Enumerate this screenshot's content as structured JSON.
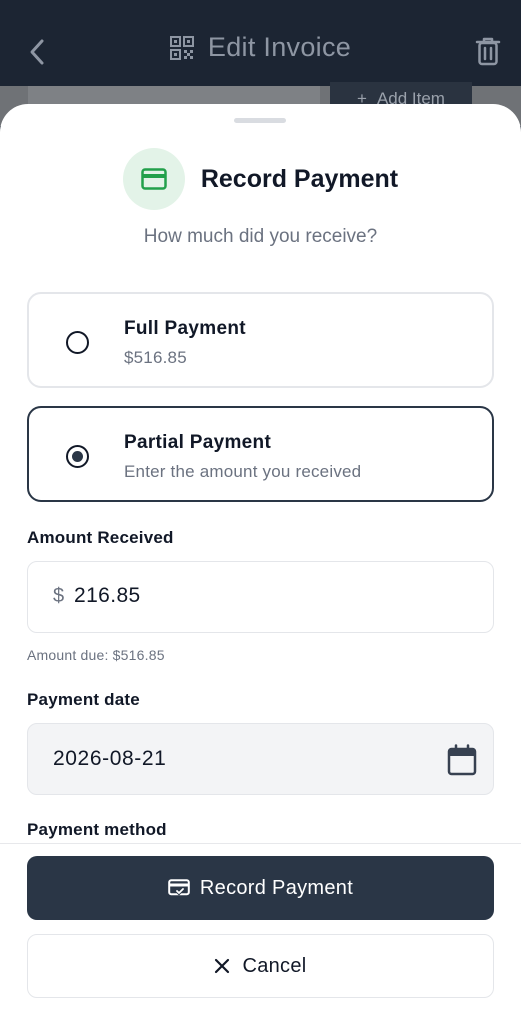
{
  "header": {
    "title": "Edit Invoice",
    "back_icon": "chevron-left-icon",
    "qr_icon": "qr-code-icon",
    "trash_icon": "trash-icon",
    "add_item_label": "Add Item"
  },
  "sheet": {
    "title": "Record Payment",
    "title_icon": "credit-card-icon",
    "subtitle": "How much did you receive?",
    "options": [
      {
        "title": "Full Payment",
        "subtitle": "$516.85",
        "selected": false
      },
      {
        "title": "Partial Payment",
        "subtitle": "Enter the amount you received",
        "selected": true
      }
    ],
    "amount": {
      "label": "Amount Received",
      "currency_symbol": "$",
      "value": "216.85",
      "helper": "Amount due: $516.85"
    },
    "date": {
      "label": "Payment date",
      "value": "2026-08-21"
    },
    "method": {
      "label": "Payment method"
    },
    "primary_button": "Record Payment",
    "cancel_button": "Cancel"
  },
  "colors": {
    "header_bg": "#1c2533",
    "primary": "#2a3646",
    "icon_bg_green": "#e3f3e8",
    "icon_green": "#22a04b"
  }
}
